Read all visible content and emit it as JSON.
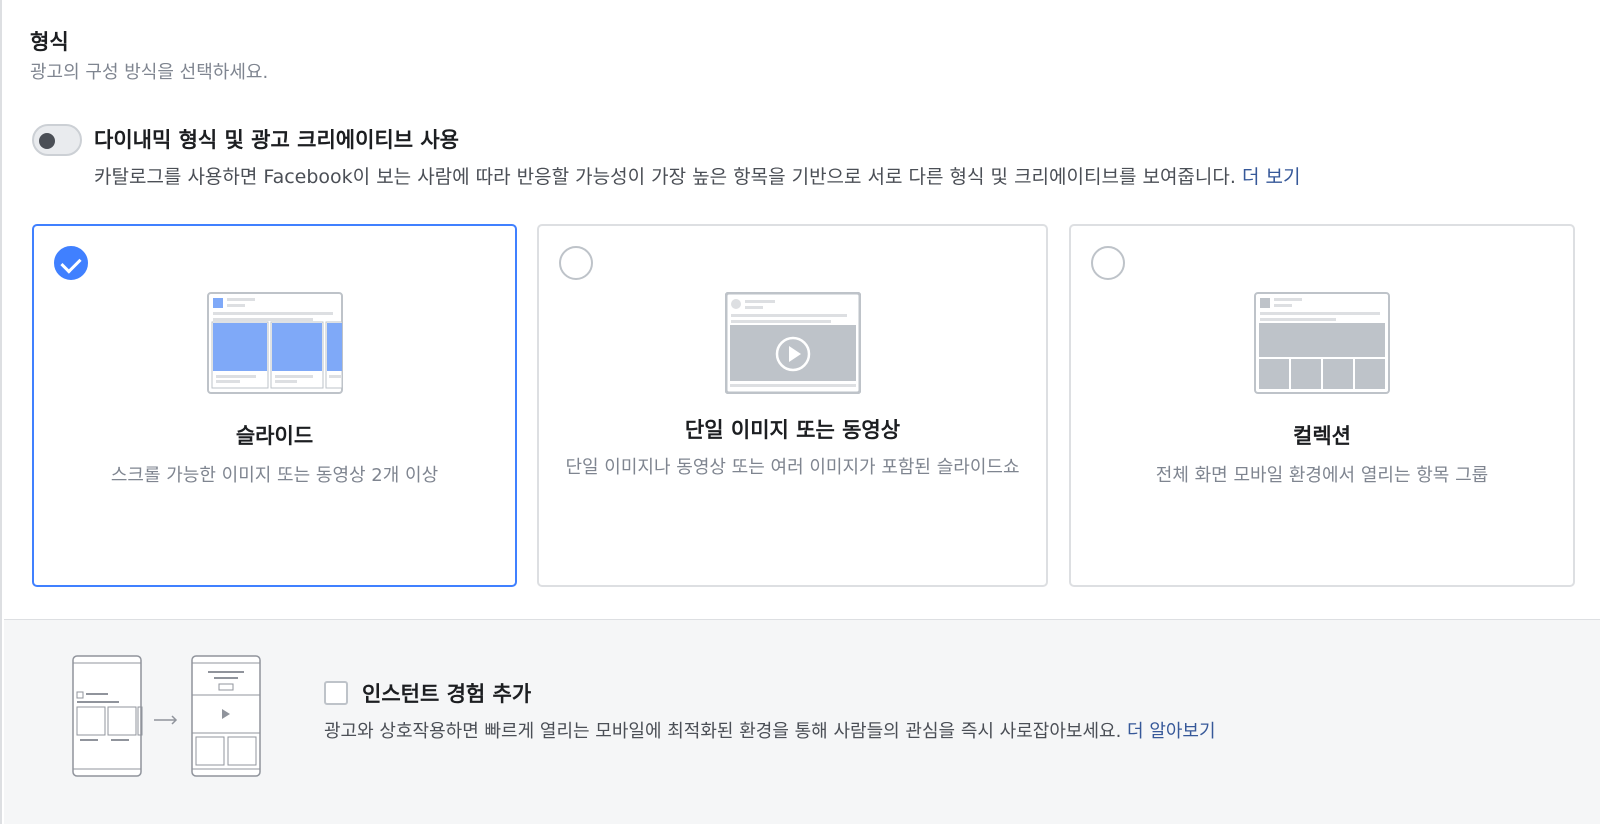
{
  "format_section": {
    "title": "형식",
    "subtitle": "광고의 구성 방식을 선택하세요."
  },
  "dynamic": {
    "toggle_on": false,
    "title": "다이내믹 형식 및 광고 크리에이티브 사용",
    "description": "카탈로그를 사용하면 Facebook이 보는 사람에 따라 반응할 가능성이 가장 높은 항목을 기반으로 서로 다른 형식 및 크리에이티브를 보여줍니다.",
    "link": "더 보기"
  },
  "options": [
    {
      "title": "슬라이드",
      "description": "스크롤 가능한 이미지 또는 동영상 2개 이상",
      "selected": true
    },
    {
      "title": "단일 이미지 또는 동영상",
      "description": "단일 이미지나 동영상 또는 여러 이미지가 포함된 슬라이드쇼",
      "selected": false
    },
    {
      "title": "컬렉션",
      "description": "전체 화면 모바일 환경에서 열리는 항목 그룹",
      "selected": false
    }
  ],
  "instant": {
    "checked": false,
    "title": "인스턴트 경험 추가",
    "description": "광고와 상호작용하면 빠르게 열리는 모바일에 최적화된 환경을 통해 사람들의 관심을 즉시 사로잡아보세요.",
    "link": "더 알아보기"
  },
  "colors": {
    "accent": "#4080ff",
    "link": "#365899",
    "border": "#dddfe2",
    "muted_text": "#7f8590",
    "illustration_fill": "#7fa9f8"
  }
}
